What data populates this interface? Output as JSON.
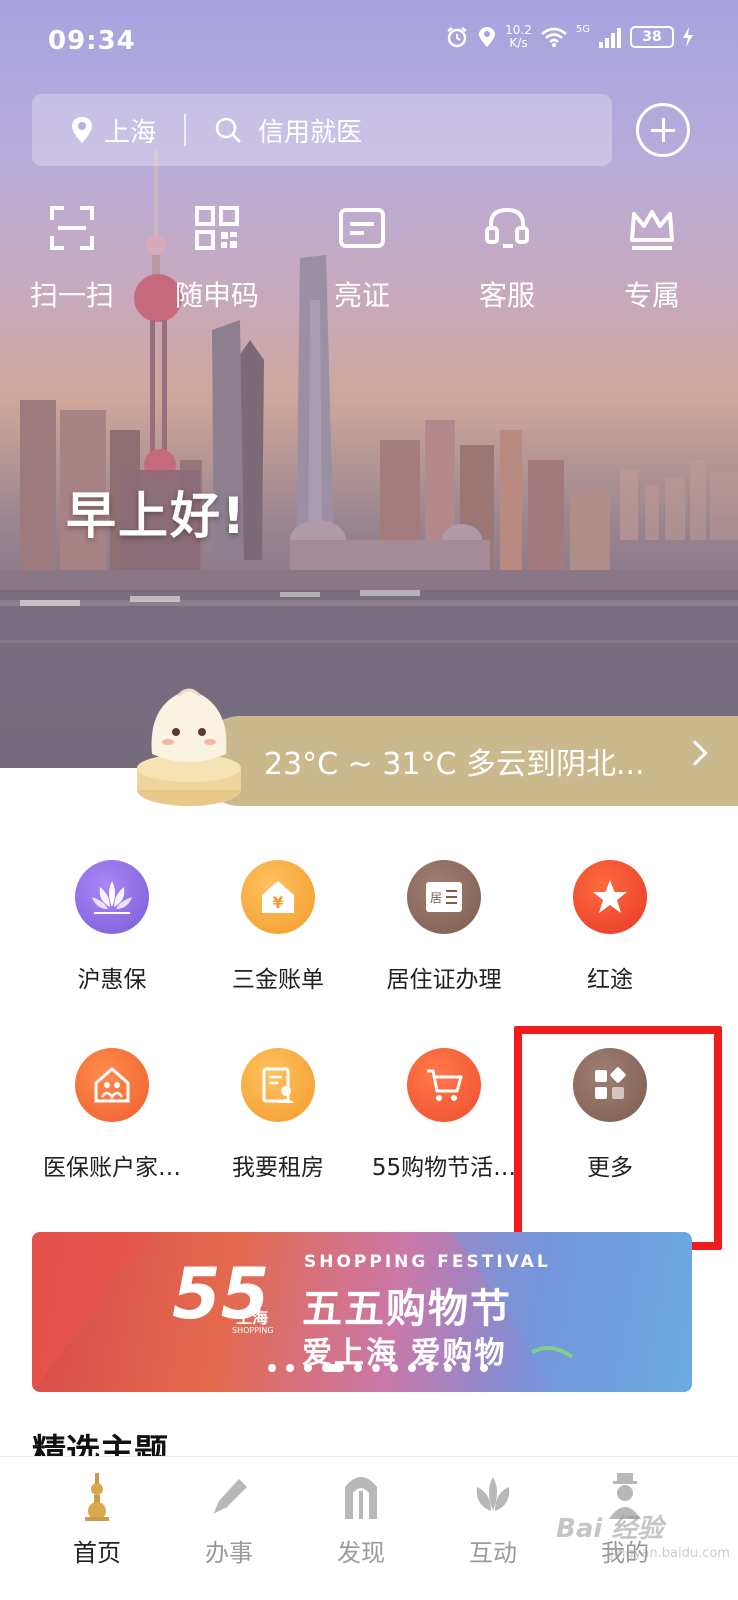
{
  "status_bar": {
    "time": "09:34",
    "net_speed_value": "10.2",
    "net_speed_unit": "K/s",
    "signal_label": "5G",
    "battery": "38"
  },
  "header": {
    "location": "上海",
    "search_placeholder": "信用就医"
  },
  "quick_actions": [
    {
      "label": "扫一扫",
      "icon": "scan-icon"
    },
    {
      "label": "随申码",
      "icon": "qr-code-icon"
    },
    {
      "label": "亮证",
      "icon": "card-icon"
    },
    {
      "label": "客服",
      "icon": "headset-icon"
    },
    {
      "label": "专属",
      "icon": "crown-icon"
    }
  ],
  "greeting": "早上好!",
  "weather": {
    "text": "23°C ~ 31°C  多云到阴北..."
  },
  "services": [
    {
      "label": "沪惠保",
      "icon": "lotus-icon",
      "color": "#8f6fe0"
    },
    {
      "label": "三金账单",
      "icon": "yuan-house-icon",
      "color": "#f5a23a"
    },
    {
      "label": "居住证办理",
      "icon": "residence-card-icon",
      "color": "#8c6a5c"
    },
    {
      "label": "红途",
      "icon": "star-icon",
      "color": "#f1462d"
    },
    {
      "label": "医保账户家…",
      "icon": "family-house-icon",
      "color": "#f3733a"
    },
    {
      "label": "我要租房",
      "icon": "rent-document-icon",
      "color": "#f5a23a"
    },
    {
      "label": "55购物节活…",
      "icon": "cart-icon",
      "color": "#f25a3a"
    },
    {
      "label": "更多",
      "icon": "more-grid-icon",
      "color": "#8c6a5c"
    }
  ],
  "banner": {
    "logo_number": "55",
    "logo_city": "上海",
    "logo_shopping": "SHOPPING",
    "subtitle_en": "SHOPPING FESTIVAL",
    "title": "五五购物节",
    "slogan": "爱上海 爱购物"
  },
  "section_title": "精选主题",
  "tabs": [
    {
      "label": "首页",
      "icon": "home-tower-icon",
      "active": true
    },
    {
      "label": "办事",
      "icon": "pen-icon",
      "active": false
    },
    {
      "label": "发现",
      "icon": "arch-icon",
      "active": false
    },
    {
      "label": "互动",
      "icon": "magnolia-icon",
      "active": false
    },
    {
      "label": "我的",
      "icon": "profile-icon",
      "active": false
    }
  ],
  "watermark": {
    "text": "Bai 经验",
    "sub": "jingyan.baidu.com"
  }
}
